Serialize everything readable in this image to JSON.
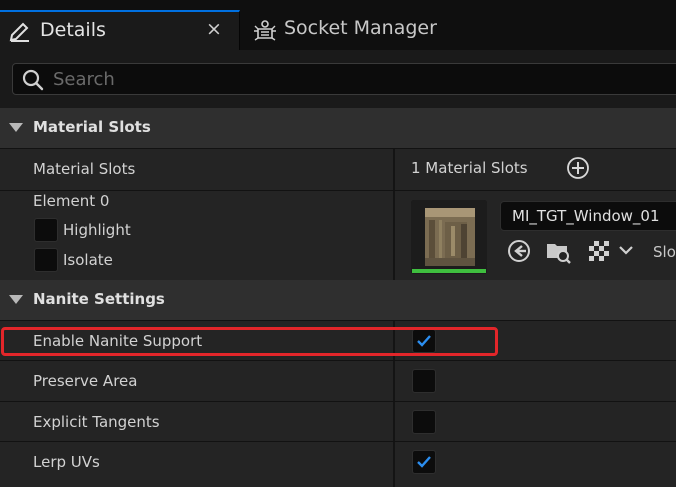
{
  "tabs": [
    {
      "label": "Details",
      "close": "×",
      "icon": "details-pencil-icon"
    },
    {
      "label": "Socket Manager",
      "icon": "socket-manager-icon"
    }
  ],
  "search": {
    "placeholder": "Search",
    "value": ""
  },
  "sections": {
    "material_slots": {
      "title": "Material Slots",
      "row_label": "Material Slots",
      "row_value": "1 Material Slots",
      "element": {
        "label": "Element 0",
        "highlight_label": "Highlight",
        "isolate_label": "Isolate",
        "highlight_checked": false,
        "isolate_checked": false,
        "material_name": "MI_TGT_Window_01",
        "slot_label_truncated": "Slo"
      }
    },
    "nanite": {
      "title": "Nanite Settings",
      "rows": [
        {
          "label": "Enable Nanite Support",
          "checked": true
        },
        {
          "label": "Preserve Area",
          "checked": false
        },
        {
          "label": "Explicit Tangents",
          "checked": false
        },
        {
          "label": "Lerp UVs",
          "checked": true
        }
      ]
    }
  },
  "colors": {
    "accent": "#0070e0",
    "checkmark": "#2b8ef0",
    "highlight_outline": "#e3262a",
    "thumb_strip": "#3fbf3f"
  }
}
